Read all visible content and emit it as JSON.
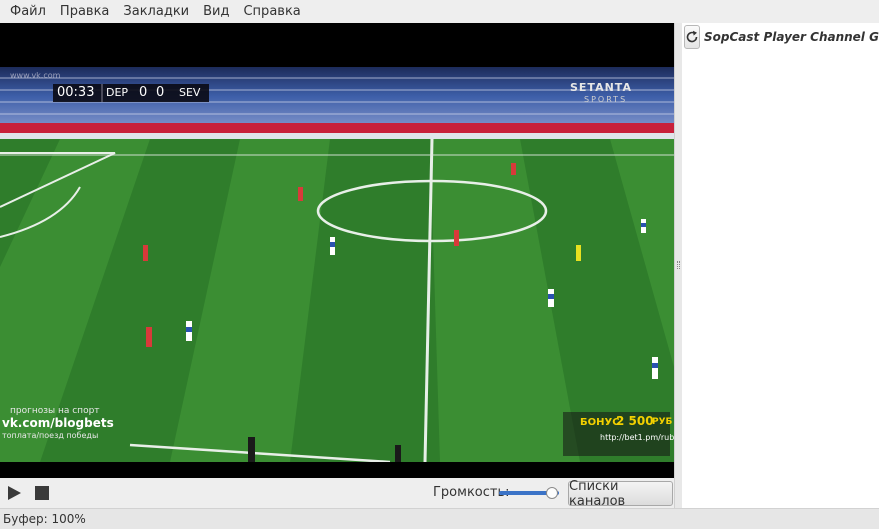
{
  "menu": [
    "Файл",
    "Правка",
    "Закладки",
    "Вид",
    "Справка"
  ],
  "video": {
    "scoreboard": {
      "time": "00:33",
      "home": "DEP",
      "home_score": "0",
      "away_score": "0",
      "away": "SEV"
    },
    "broadcaster": "SETANTA",
    "broadcaster_sub": "SPORTS",
    "watermark": "www.vk.com",
    "promo_left": {
      "line1": "прогнозы на спорт",
      "line2": "vk.com/blogbets",
      "line3": "топлата/поезд победы"
    },
    "promo_right": {
      "line1": "БОНУС",
      "amount": "2 500",
      "currency": "РУБ",
      "url": "http://bet1.pm/rub"
    }
  },
  "side": {
    "title": "SopCast Player Channel Guide"
  },
  "controls": {
    "volume_label": "Громкость:",
    "volume_level": 0.9,
    "channels_button": "Списки каналов"
  },
  "status": {
    "text": "Буфер: 100%"
  },
  "colors": {
    "accent": "#3b73c7",
    "pitch_dark": "#2e7a2a",
    "pitch_light": "#3b8d33"
  }
}
